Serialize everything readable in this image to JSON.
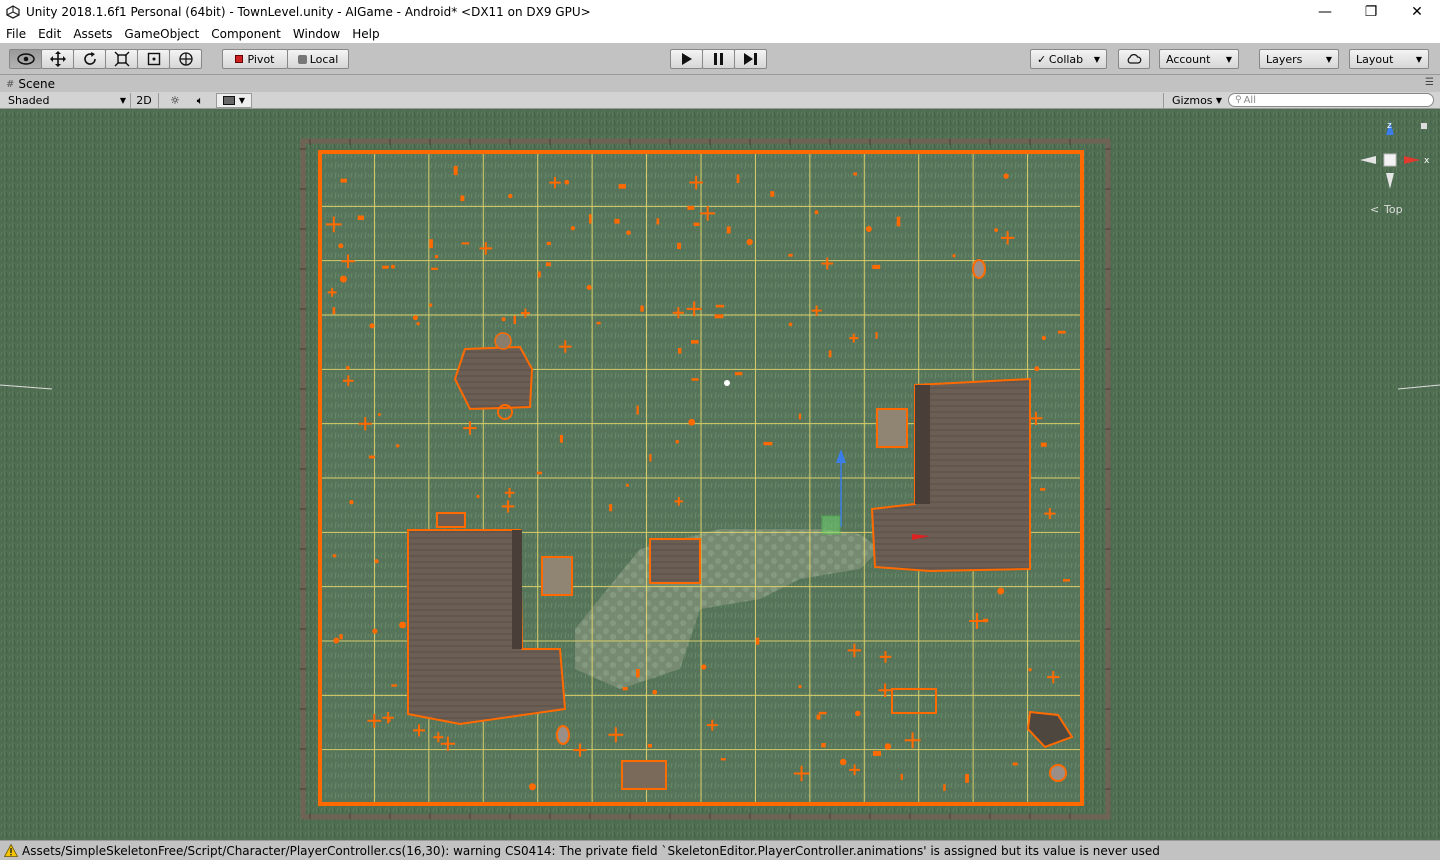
{
  "window": {
    "title": "Unity 2018.1.6f1 Personal (64bit) - TownLevel.unity - AIGame - Android* <DX11 on DX9 GPU>",
    "minimize": "—",
    "maximize": "❐",
    "close": "✕"
  },
  "menu": [
    "File",
    "Edit",
    "Assets",
    "GameObject",
    "Component",
    "Window",
    "Help"
  ],
  "toolbar": {
    "pivot": "Pivot",
    "local": "Local",
    "collab": "Collab",
    "account": "Account",
    "layers": "Layers",
    "layout": "Layout"
  },
  "scene_tab": {
    "label": "Scene",
    "shading": "Shaded",
    "mode_2d": "2D",
    "gizmos": "Gizmos",
    "search_placeholder": "All"
  },
  "gizmo": {
    "axis_z": "z",
    "axis_x": "x",
    "view_label": "Top"
  },
  "status": {
    "message": "Assets/SimpleSkeletonFree/Script/Character/PlayerController.cs(16,30): warning CS0414: The private field `SkeletonEditor.PlayerController.animations' is assigned but its value is never used"
  },
  "colors": {
    "selection_orange": "#ff6a00",
    "grid_yellow": "#e8d86a",
    "grass": "#4d6b4f",
    "roof": "#6b5c52"
  }
}
